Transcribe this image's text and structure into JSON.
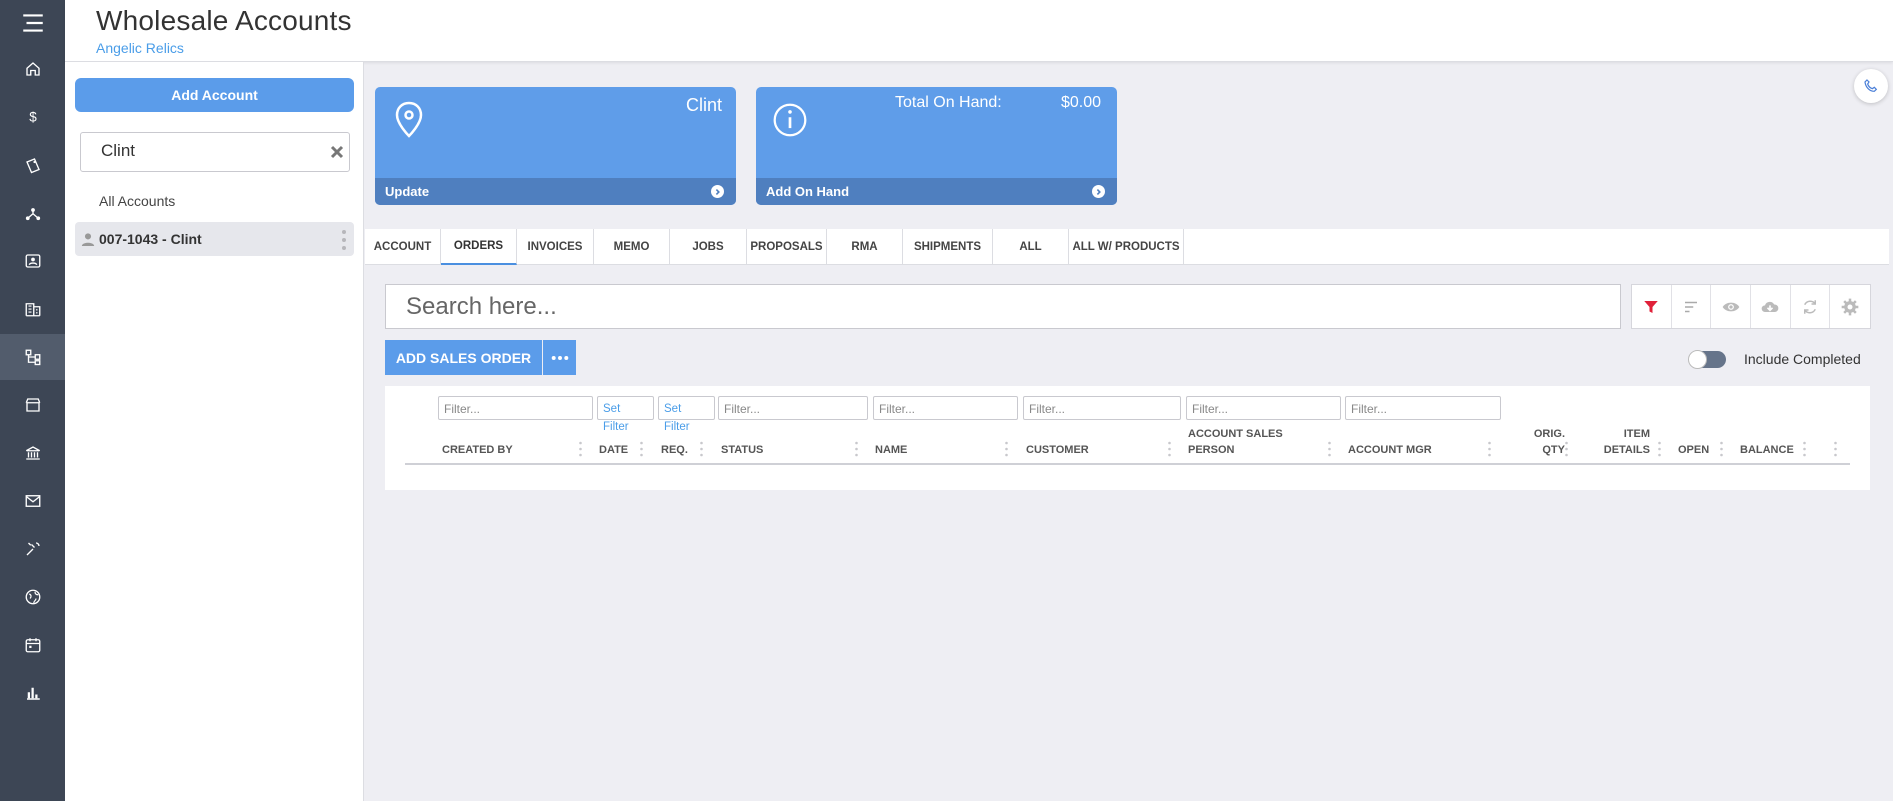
{
  "header": {
    "title": "Wholesale Accounts",
    "subtitle": "Angelic Relics"
  },
  "rail": {
    "items": [
      {
        "icon": "menu-icon"
      },
      {
        "icon": "home-icon"
      },
      {
        "icon": "dollar-icon"
      },
      {
        "icon": "tag-icon"
      },
      {
        "icon": "network-icon"
      },
      {
        "icon": "contact-card-icon"
      },
      {
        "icon": "building-icon"
      },
      {
        "icon": "hierarchy-icon",
        "active": true
      },
      {
        "icon": "store-icon"
      },
      {
        "icon": "bank-icon"
      },
      {
        "icon": "mail-icon"
      },
      {
        "icon": "tools-icon"
      },
      {
        "icon": "globe-icon"
      },
      {
        "icon": "calendar-icon"
      },
      {
        "icon": "bar-chart-icon"
      }
    ]
  },
  "left_panel": {
    "add_account_label": "Add Account",
    "search_value": "Clint",
    "all_accounts_label": "All Accounts",
    "accounts": [
      {
        "label": "007-1043 - Clint"
      }
    ]
  },
  "cards": {
    "location": {
      "name": "Clint",
      "footer": "Update"
    },
    "on_hand": {
      "total_label": "Total On Hand:",
      "total_value": "$0.00",
      "footer": "Add On Hand"
    }
  },
  "tabs": [
    "ACCOUNT",
    "ORDERS",
    "INVOICES",
    "MEMO",
    "JOBS",
    "PROPOSALS",
    "RMA",
    "SHIPMENTS",
    "ALL",
    "ALL W/ PRODUCTS"
  ],
  "active_tab": "ORDERS",
  "search": {
    "placeholder": "Search here..."
  },
  "toolbar": {
    "icons": [
      "filter-icon",
      "sort-icon",
      "eye-icon",
      "cloud-download-icon",
      "refresh-icon",
      "gear-icon"
    ],
    "accent": "#e0213a"
  },
  "orders": {
    "add_label": "ADD SALES ORDER",
    "include_completed_label": "Include Completed",
    "filter_placeholder": "Filter...",
    "set_filter_label": "Set Filter",
    "columns": {
      "created_by": "CREATED BY",
      "date": "DATE",
      "req": "REQ.",
      "status": "STATUS",
      "name": "NAME",
      "customer": "CUSTOMER",
      "account_sales_person": "ACCOUNT SALES PERSON",
      "account_mgr": "ACCOUNT MGR",
      "orig_qty": "ORIG. QTY",
      "item_details": "ITEM DETAILS",
      "open": "OPEN",
      "balance": "BALANCE"
    }
  },
  "colors": {
    "primary": "#5b9cea",
    "card_footer": "#4f7fbf",
    "rail": "#3d4655",
    "link": "#4a9de8"
  }
}
